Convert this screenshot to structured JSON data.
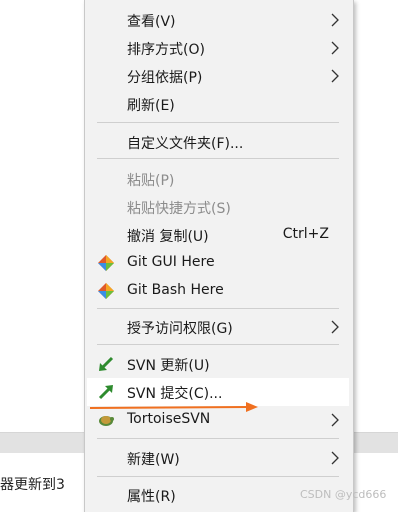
{
  "background": {
    "left_text": "器更新到3"
  },
  "menu": {
    "items": [
      {
        "label": "查看(V)"
      },
      {
        "label": "排序方式(O)"
      },
      {
        "label": "分组依据(P)"
      },
      {
        "label": "刷新(E)"
      },
      {
        "label": "自定义文件夹(F)..."
      },
      {
        "label": "粘贴(P)"
      },
      {
        "label": "粘贴快捷方式(S)"
      },
      {
        "label": "撤消 复制(U)",
        "shortcut": "Ctrl+Z"
      },
      {
        "label": "Git GUI Here"
      },
      {
        "label": "Git Bash Here"
      },
      {
        "label": "授予访问权限(G)"
      },
      {
        "label": "SVN 更新(U)"
      },
      {
        "label": "SVN 提交(C)..."
      },
      {
        "label": "TortoiseSVN"
      },
      {
        "label": "新建(W)"
      },
      {
        "label": "属性(R)"
      }
    ]
  },
  "watermark": "CSDN @ycd666",
  "colors": {
    "annotation_arrow": "#f07020",
    "svn_update_icon": "#2e8b2e",
    "svn_commit_icon": "#2e8b2e"
  }
}
